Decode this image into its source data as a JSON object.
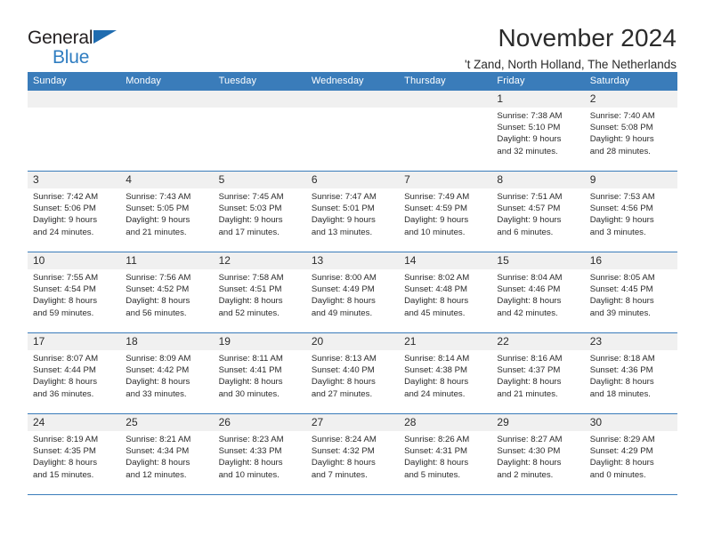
{
  "brand": {
    "name_part1": "General",
    "name_part2": "Blue",
    "triangle_icon": "triangle-icon",
    "accent_color": "#2f7dc1"
  },
  "header": {
    "title": "November 2024",
    "subtitle": "'t Zand, North Holland, The Netherlands"
  },
  "calendar": {
    "header_color": "#3a7cba",
    "daynum_band_color": "#f0f0f0",
    "weekday_headers": [
      "Sunday",
      "Monday",
      "Tuesday",
      "Wednesday",
      "Thursday",
      "Friday",
      "Saturday"
    ],
    "weeks": [
      [
        {
          "day": "",
          "sunrise": "",
          "sunset": "",
          "daylight_line1": "",
          "daylight_line2": ""
        },
        {
          "day": "",
          "sunrise": "",
          "sunset": "",
          "daylight_line1": "",
          "daylight_line2": ""
        },
        {
          "day": "",
          "sunrise": "",
          "sunset": "",
          "daylight_line1": "",
          "daylight_line2": ""
        },
        {
          "day": "",
          "sunrise": "",
          "sunset": "",
          "daylight_line1": "",
          "daylight_line2": ""
        },
        {
          "day": "",
          "sunrise": "",
          "sunset": "",
          "daylight_line1": "",
          "daylight_line2": ""
        },
        {
          "day": "1",
          "sunrise": "Sunrise: 7:38 AM",
          "sunset": "Sunset: 5:10 PM",
          "daylight_line1": "Daylight: 9 hours",
          "daylight_line2": "and 32 minutes."
        },
        {
          "day": "2",
          "sunrise": "Sunrise: 7:40 AM",
          "sunset": "Sunset: 5:08 PM",
          "daylight_line1": "Daylight: 9 hours",
          "daylight_line2": "and 28 minutes."
        }
      ],
      [
        {
          "day": "3",
          "sunrise": "Sunrise: 7:42 AM",
          "sunset": "Sunset: 5:06 PM",
          "daylight_line1": "Daylight: 9 hours",
          "daylight_line2": "and 24 minutes."
        },
        {
          "day": "4",
          "sunrise": "Sunrise: 7:43 AM",
          "sunset": "Sunset: 5:05 PM",
          "daylight_line1": "Daylight: 9 hours",
          "daylight_line2": "and 21 minutes."
        },
        {
          "day": "5",
          "sunrise": "Sunrise: 7:45 AM",
          "sunset": "Sunset: 5:03 PM",
          "daylight_line1": "Daylight: 9 hours",
          "daylight_line2": "and 17 minutes."
        },
        {
          "day": "6",
          "sunrise": "Sunrise: 7:47 AM",
          "sunset": "Sunset: 5:01 PM",
          "daylight_line1": "Daylight: 9 hours",
          "daylight_line2": "and 13 minutes."
        },
        {
          "day": "7",
          "sunrise": "Sunrise: 7:49 AM",
          "sunset": "Sunset: 4:59 PM",
          "daylight_line1": "Daylight: 9 hours",
          "daylight_line2": "and 10 minutes."
        },
        {
          "day": "8",
          "sunrise": "Sunrise: 7:51 AM",
          "sunset": "Sunset: 4:57 PM",
          "daylight_line1": "Daylight: 9 hours",
          "daylight_line2": "and 6 minutes."
        },
        {
          "day": "9",
          "sunrise": "Sunrise: 7:53 AM",
          "sunset": "Sunset: 4:56 PM",
          "daylight_line1": "Daylight: 9 hours",
          "daylight_line2": "and 3 minutes."
        }
      ],
      [
        {
          "day": "10",
          "sunrise": "Sunrise: 7:55 AM",
          "sunset": "Sunset: 4:54 PM",
          "daylight_line1": "Daylight: 8 hours",
          "daylight_line2": "and 59 minutes."
        },
        {
          "day": "11",
          "sunrise": "Sunrise: 7:56 AM",
          "sunset": "Sunset: 4:52 PM",
          "daylight_line1": "Daylight: 8 hours",
          "daylight_line2": "and 56 minutes."
        },
        {
          "day": "12",
          "sunrise": "Sunrise: 7:58 AM",
          "sunset": "Sunset: 4:51 PM",
          "daylight_line1": "Daylight: 8 hours",
          "daylight_line2": "and 52 minutes."
        },
        {
          "day": "13",
          "sunrise": "Sunrise: 8:00 AM",
          "sunset": "Sunset: 4:49 PM",
          "daylight_line1": "Daylight: 8 hours",
          "daylight_line2": "and 49 minutes."
        },
        {
          "day": "14",
          "sunrise": "Sunrise: 8:02 AM",
          "sunset": "Sunset: 4:48 PM",
          "daylight_line1": "Daylight: 8 hours",
          "daylight_line2": "and 45 minutes."
        },
        {
          "day": "15",
          "sunrise": "Sunrise: 8:04 AM",
          "sunset": "Sunset: 4:46 PM",
          "daylight_line1": "Daylight: 8 hours",
          "daylight_line2": "and 42 minutes."
        },
        {
          "day": "16",
          "sunrise": "Sunrise: 8:05 AM",
          "sunset": "Sunset: 4:45 PM",
          "daylight_line1": "Daylight: 8 hours",
          "daylight_line2": "and 39 minutes."
        }
      ],
      [
        {
          "day": "17",
          "sunrise": "Sunrise: 8:07 AM",
          "sunset": "Sunset: 4:44 PM",
          "daylight_line1": "Daylight: 8 hours",
          "daylight_line2": "and 36 minutes."
        },
        {
          "day": "18",
          "sunrise": "Sunrise: 8:09 AM",
          "sunset": "Sunset: 4:42 PM",
          "daylight_line1": "Daylight: 8 hours",
          "daylight_line2": "and 33 minutes."
        },
        {
          "day": "19",
          "sunrise": "Sunrise: 8:11 AM",
          "sunset": "Sunset: 4:41 PM",
          "daylight_line1": "Daylight: 8 hours",
          "daylight_line2": "and 30 minutes."
        },
        {
          "day": "20",
          "sunrise": "Sunrise: 8:13 AM",
          "sunset": "Sunset: 4:40 PM",
          "daylight_line1": "Daylight: 8 hours",
          "daylight_line2": "and 27 minutes."
        },
        {
          "day": "21",
          "sunrise": "Sunrise: 8:14 AM",
          "sunset": "Sunset: 4:38 PM",
          "daylight_line1": "Daylight: 8 hours",
          "daylight_line2": "and 24 minutes."
        },
        {
          "day": "22",
          "sunrise": "Sunrise: 8:16 AM",
          "sunset": "Sunset: 4:37 PM",
          "daylight_line1": "Daylight: 8 hours",
          "daylight_line2": "and 21 minutes."
        },
        {
          "day": "23",
          "sunrise": "Sunrise: 8:18 AM",
          "sunset": "Sunset: 4:36 PM",
          "daylight_line1": "Daylight: 8 hours",
          "daylight_line2": "and 18 minutes."
        }
      ],
      [
        {
          "day": "24",
          "sunrise": "Sunrise: 8:19 AM",
          "sunset": "Sunset: 4:35 PM",
          "daylight_line1": "Daylight: 8 hours",
          "daylight_line2": "and 15 minutes."
        },
        {
          "day": "25",
          "sunrise": "Sunrise: 8:21 AM",
          "sunset": "Sunset: 4:34 PM",
          "daylight_line1": "Daylight: 8 hours",
          "daylight_line2": "and 12 minutes."
        },
        {
          "day": "26",
          "sunrise": "Sunrise: 8:23 AM",
          "sunset": "Sunset: 4:33 PM",
          "daylight_line1": "Daylight: 8 hours",
          "daylight_line2": "and 10 minutes."
        },
        {
          "day": "27",
          "sunrise": "Sunrise: 8:24 AM",
          "sunset": "Sunset: 4:32 PM",
          "daylight_line1": "Daylight: 8 hours",
          "daylight_line2": "and 7 minutes."
        },
        {
          "day": "28",
          "sunrise": "Sunrise: 8:26 AM",
          "sunset": "Sunset: 4:31 PM",
          "daylight_line1": "Daylight: 8 hours",
          "daylight_line2": "and 5 minutes."
        },
        {
          "day": "29",
          "sunrise": "Sunrise: 8:27 AM",
          "sunset": "Sunset: 4:30 PM",
          "daylight_line1": "Daylight: 8 hours",
          "daylight_line2": "and 2 minutes."
        },
        {
          "day": "30",
          "sunrise": "Sunrise: 8:29 AM",
          "sunset": "Sunset: 4:29 PM",
          "daylight_line1": "Daylight: 8 hours",
          "daylight_line2": "and 0 minutes."
        }
      ]
    ]
  }
}
